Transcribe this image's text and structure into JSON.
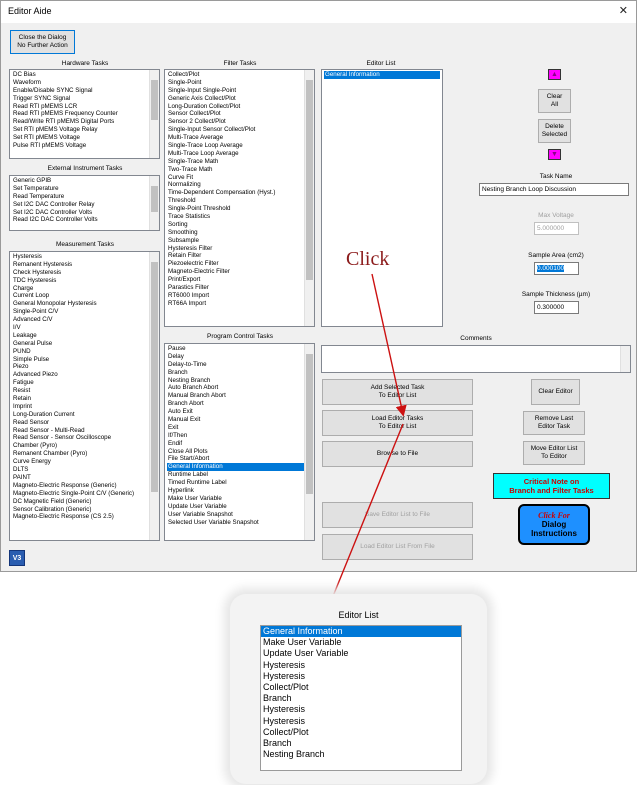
{
  "window": {
    "title": "Editor Aide",
    "close_glyph": "✕"
  },
  "buttons": {
    "close_dialog": "Close the Dialog\nNo Further Action",
    "clear_all": "Clear\nAll",
    "delete_selected": "Delete\nSelected",
    "add_selected": "Add Selected Task\nTo Editor List",
    "load_editor_tasks": "Load Editor Tasks\nTo Editor List",
    "browse_file": "Browse to File",
    "save_editor_list": "Save Editor List to File",
    "load_editor_from_file": "Load Editor List From File",
    "clear_editor": "Clear Editor",
    "remove_last": "Remove Last\nEditor Task",
    "move_editor": "Move Editor List\nTo Editor",
    "critical_note": "Critical Note on\nBranch and Filter Tasks",
    "click_for": "Click For",
    "dialog_instructions": "Dialog\nInstructions",
    "up_glyph": "▲",
    "down_glyph": "▼"
  },
  "sections": {
    "hardware": "Hardware Tasks",
    "external": "External Instrument Tasks",
    "measurement": "Measurement Tasks",
    "filter": "Filter Tasks",
    "program": "Program Control Tasks",
    "editor": "Editor List",
    "comments": "Comments"
  },
  "hardware_tasks": [
    "DC Bias",
    "Waveform",
    "Enable/Disable SYNC Signal",
    "Trigger SYNC Signal",
    "Read RTI pMEMS LCR",
    "Read RTI pMEMS Frequency Counter",
    "Read/Write RTI pMEMS Digital Ports",
    "Set RTI pMEMS Voltage Relay",
    "Set RTI pMEMS Voltage",
    "Pulse RTI pMEMS Voltage"
  ],
  "external_tasks": [
    "Generic GPIB",
    "Set Temperature",
    "Read Temperature",
    "Set I2C DAC Controller Relay",
    "Set I2C DAC Controller Volts",
    "Read I2C DAC Controller Volts"
  ],
  "measurement_tasks": [
    "Hysteresis",
    "Remanent Hysteresis",
    "Check Hysteresis",
    "TDC Hysteresis",
    "Charge",
    "Current Loop",
    "General Monopolar Hysteresis",
    "Single-Point C/V",
    "Advanced C/V",
    "I/V",
    "Leakage",
    "General Pulse",
    "PUND",
    "Simple Pulse",
    "Piezo",
    "Advanced Piezo",
    "Fatigue",
    "Resist",
    "Retain",
    "Imprint",
    "Long-Duration Current",
    "Read Sensor",
    "Read Sensor - Multi-Read",
    "Read Sensor - Sensor Oscilloscope",
    "Chamber (Pyro)",
    "Remanent Chamber (Pyro)",
    "Curve Energy",
    "DLTS",
    "PAINT",
    "Magneto-Electric Response (Generic)",
    "Magneto-Electric Single-Point C/V (Generic)",
    "DC Magnetic Field (Generic)",
    "Sensor Calibration (Generic)",
    "Magneto-Electric Response (CS 2.5)"
  ],
  "filter_tasks": [
    "Collect/Plot",
    "Single-Point",
    "Single-Input Single-Point",
    "Generic Axis Collect/Plot",
    "Long-Duration Collect/Plot",
    "Sensor Collect/Plot",
    "Sensor 2 Collect/Plot",
    "Single-Input Sensor Collect/Plot",
    "Multi-Trace Average",
    "Single-Trace Loop Average",
    "Multi-Trace Loop Average",
    "Single-Trace Math",
    "Two-Trace Math",
    "Curve Fit",
    "Normalizing",
    "Time-Dependent Compensation (Hyst.)",
    "Threshold",
    "Single-Point Threshold",
    "Trace Statistics",
    "Sorting",
    "Smoothing",
    "Subsample",
    "Hysteresis Filter",
    "Retain Filter",
    "Piezoelectric Filter",
    "Magneto-Electric Filter",
    "Print/Export",
    "Parastics Filter",
    "RT6000 Import",
    "RT66A Import"
  ],
  "program_tasks": [
    "Pause",
    "Delay",
    "Delay-to-Time",
    "Branch",
    "Nesting Branch",
    "Auto Branch Abort",
    "Manual Branch Abort",
    "Branch Abort",
    "Auto Exit",
    "Manual Exit",
    "Exit",
    "If/Then",
    "Endif",
    "Close All Plots",
    "File Start/Abort",
    "General Information",
    "Runtime Label",
    "Timed Runtime Label",
    "Hyperlink",
    "Make User Variable",
    "Update User Variable",
    "User Variable Snapshot",
    "Selected User Variable Snapshot"
  ],
  "program_selected": "General Information",
  "editor_list": [
    "General Information"
  ],
  "fields": {
    "task_name_label": "Task Name",
    "task_name_value": "Nesting Branch Loop Discussion",
    "max_voltage_label": "Max Voltage",
    "max_voltage_value": "5.000000",
    "sample_area_label": "Sample Area (cm2)",
    "sample_area_value": "0.000100",
    "thickness_label": "Sample Thickness (µm)",
    "thickness_value": "0.300000"
  },
  "annotation": {
    "click_text": "Click"
  },
  "zoom": {
    "title": "Editor List",
    "items": [
      "General Information",
      "Make User Variable",
      "Update User Variable",
      "Hysteresis",
      "Hysteresis",
      "Collect/Plot",
      "Branch",
      "Hysteresis",
      "Hysteresis",
      "Collect/Plot",
      "Branch",
      "Nesting Branch"
    ]
  },
  "colors": {
    "selection": "#0078d7",
    "magenta": "#ff00ff",
    "cyan": "#00ffff",
    "instructions_blue": "#1e90ff",
    "critical_red": "#cc0000",
    "arrow": "#cc1111"
  },
  "app_icon_label": "V3"
}
